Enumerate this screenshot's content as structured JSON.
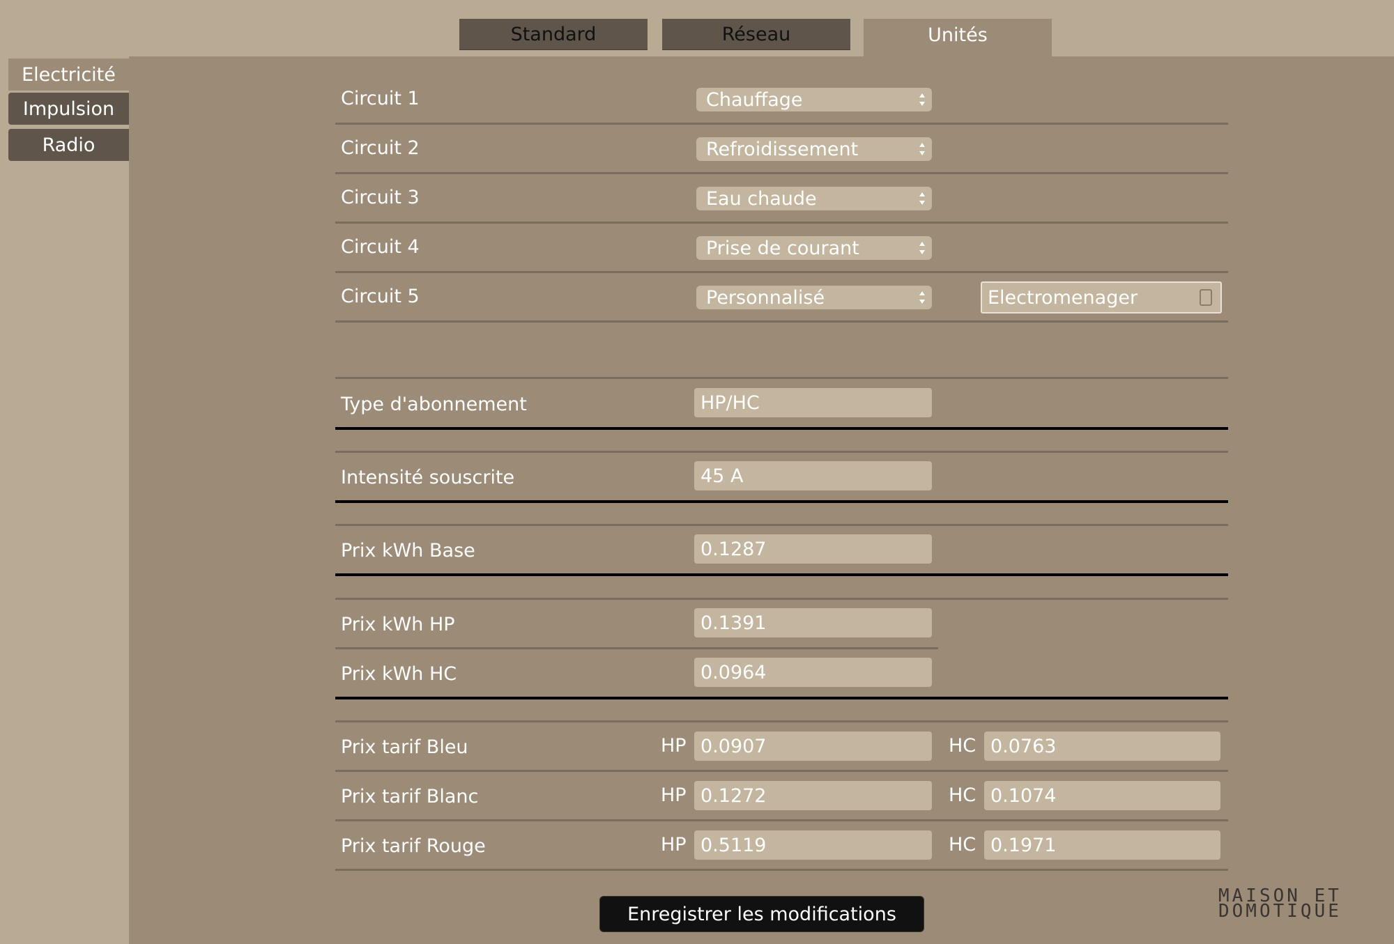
{
  "tabs": [
    {
      "label": "Standard",
      "active": false
    },
    {
      "label": "Réseau",
      "active": false
    },
    {
      "label": "Unités",
      "active": true
    }
  ],
  "sidebar": [
    {
      "label": "Electricité",
      "active": true
    },
    {
      "label": "Impulsion",
      "active": false
    },
    {
      "label": "Radio",
      "active": false
    }
  ],
  "circuits": [
    {
      "label": "Circuit 1",
      "value": "Chauffage"
    },
    {
      "label": "Circuit 2",
      "value": "Refroidissement"
    },
    {
      "label": "Circuit 3",
      "value": "Eau chaude"
    },
    {
      "label": "Circuit 4",
      "value": "Prise de courant"
    },
    {
      "label": "Circuit 5",
      "value": "Personnalisé",
      "custom_name": "Electromenager"
    }
  ],
  "abonnement": {
    "label": "Type d'abonnement",
    "value": "HP/HC"
  },
  "intensite": {
    "label": "Intensité souscrite",
    "value": "45 A"
  },
  "prix_base": {
    "label": "Prix kWh Base",
    "value": "0.1287"
  },
  "prix_hp": {
    "label": "Prix kWh HP",
    "value": "0.1391"
  },
  "prix_hc": {
    "label": "Prix kWh HC",
    "value": "0.0964"
  },
  "tarifs": [
    {
      "label": "Prix tarif Bleu",
      "hp_tag": "HP",
      "hp": "0.0907",
      "hc_tag": "HC",
      "hc": "0.0763"
    },
    {
      "label": "Prix tarif Blanc",
      "hp_tag": "HP",
      "hp": "0.1272",
      "hc_tag": "HC",
      "hc": "0.1074"
    },
    {
      "label": "Prix tarif Rouge",
      "hp_tag": "HP",
      "hp": "0.5119",
      "hc_tag": "HC",
      "hc": "0.1971"
    }
  ],
  "save_label": "Enregistrer les modifications",
  "logo": {
    "line1": "MAISON ET",
    "line2": "DOMOTIQUE"
  },
  "colors": {
    "background": "#b9aa93",
    "panel": "#9c8b77",
    "tab_inactive": "#5f554a",
    "field": "#c3b59e",
    "button": "#111111"
  }
}
